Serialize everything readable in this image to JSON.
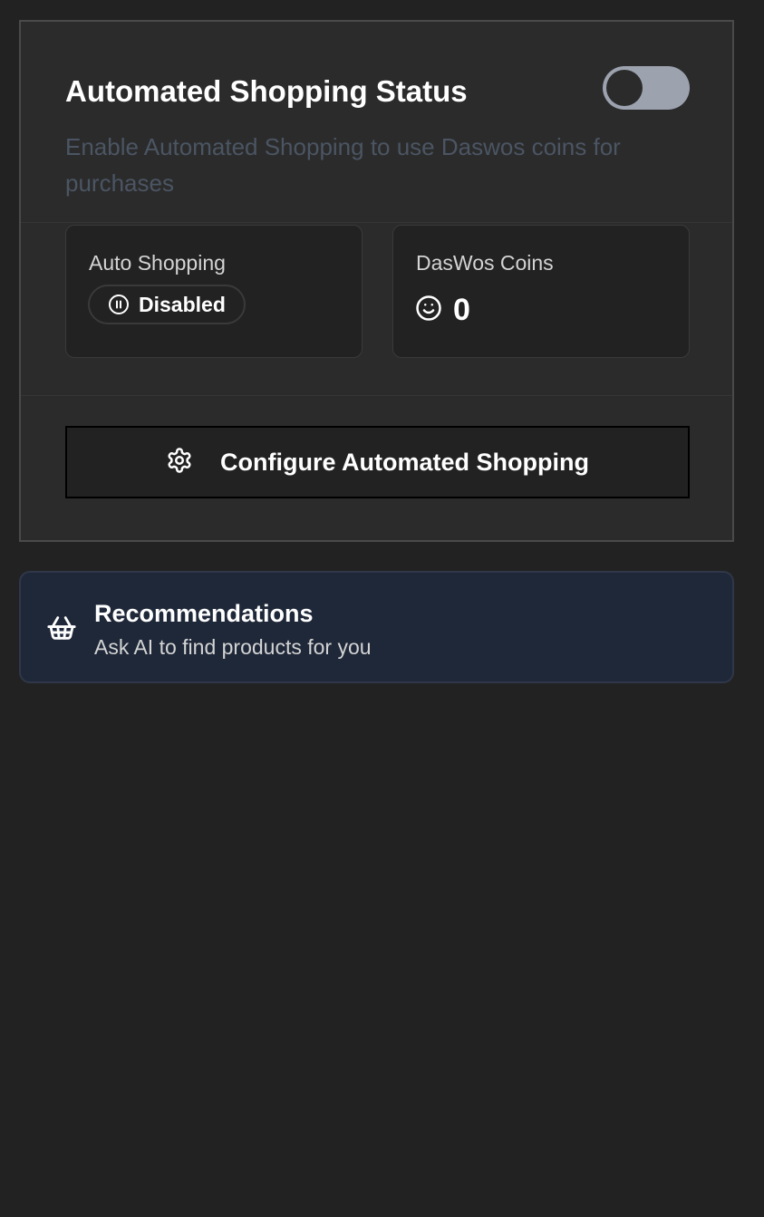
{
  "status_card": {
    "title": "Automated Shopping Status",
    "description": "Enable Automated Shopping to use Daswos coins for purchases",
    "toggle": {
      "enabled": false
    },
    "auto_shopping": {
      "label": "Auto Shopping",
      "status": "Disabled",
      "status_icon": "pause-circle-icon"
    },
    "coins": {
      "label": "DasWos Coins",
      "value": "0",
      "icon": "smile-coin-icon"
    },
    "configure_button": {
      "label": "Configure Automated Shopping",
      "icon": "gear-icon"
    }
  },
  "recommendations": {
    "title": "Recommendations",
    "subtitle": "Ask AI to find products for you",
    "icon": "shopping-basket-icon"
  },
  "colors": {
    "background": "#222222",
    "card": "#2b2b2b",
    "toggle_track": "#9ca3af",
    "muted_text": "#4b5563",
    "recommendation_bg": "#1f2839"
  }
}
